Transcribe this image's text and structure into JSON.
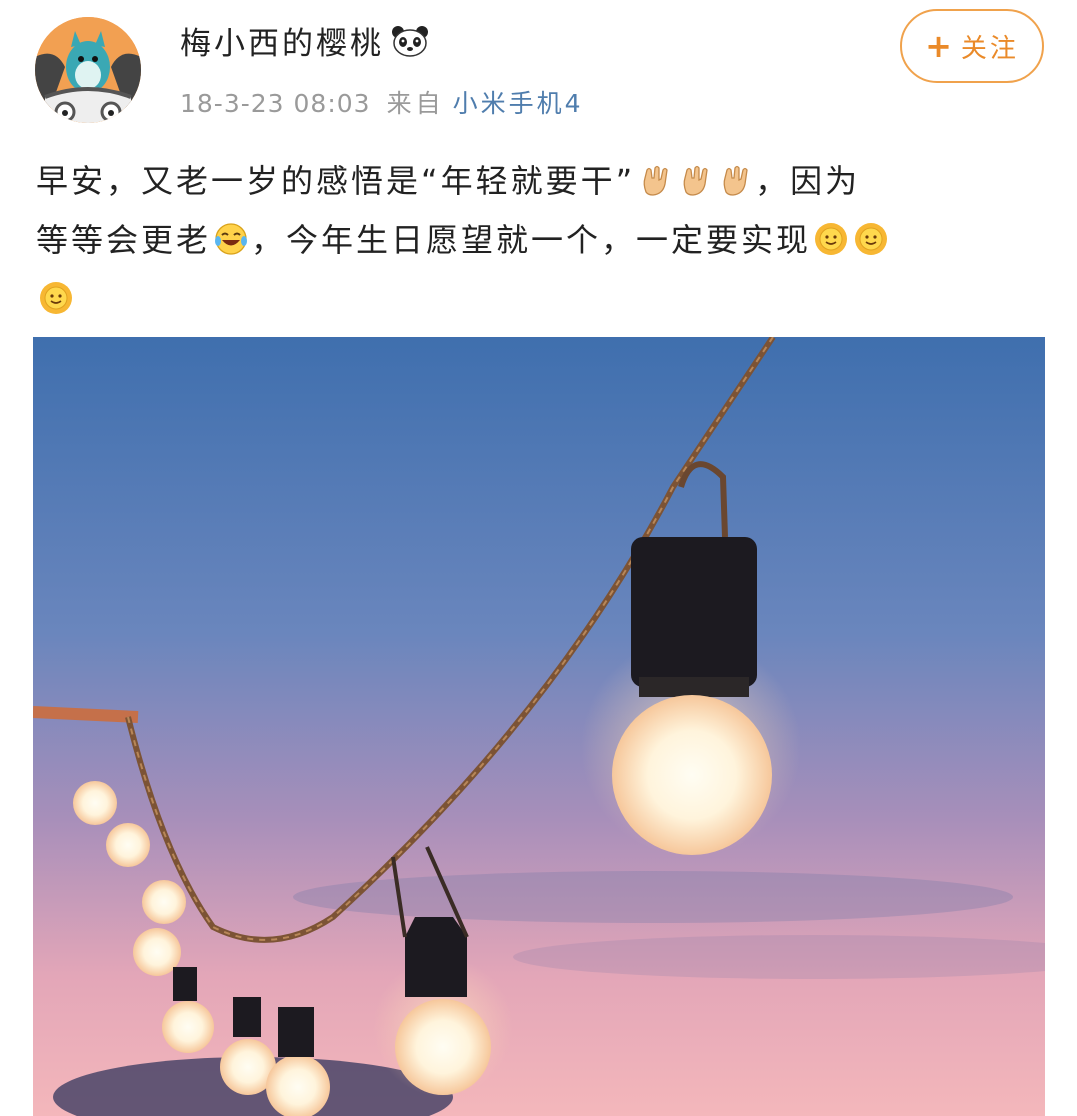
{
  "post": {
    "author": {
      "name": "梅小西的樱桃",
      "badge_icon": "panda-icon"
    },
    "meta": {
      "time": "18-3-23 08:03",
      "from_label": "来自",
      "device": "小米手机4"
    },
    "follow_button": {
      "plus": "+",
      "label": "关注"
    },
    "text": {
      "line1": "早安，又老一岁的感悟是“年轻就要干”",
      "line1_end": "，因为",
      "line2_a": "等等会更老",
      "line2_b": "，今年生日愿望就一个，一定要实现",
      "emojis": [
        "rock-hand-emoji",
        "laugh-cry-emoji",
        "sunny-smile-emoji"
      ]
    },
    "image": {
      "subject": "string-lights-photo"
    }
  },
  "colors": {
    "follow_orange": "#ea8a29",
    "device_link_blue": "#4f7dad",
    "meta_gray": "#9a9a9a"
  }
}
